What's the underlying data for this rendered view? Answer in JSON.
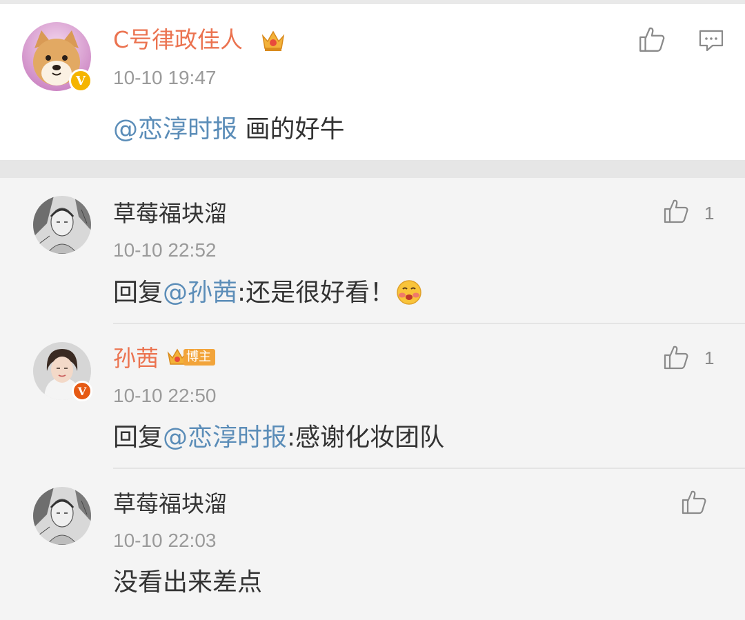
{
  "main_comment": {
    "author": "C号律政佳人",
    "time": "10-10 19:47",
    "mention": "@恋淳时报",
    "text": " 画的好牛",
    "avatar_icon": "shiba-dog-avatar",
    "verified_color": "#f5b400"
  },
  "replies": [
    {
      "author": "草莓福块溜",
      "time": "10-10 22:52",
      "prefix": "回复",
      "mention": "@孙茜",
      "text": ":还是很好看！",
      "likes": "1",
      "emoji": "blushing-face-emoji"
    },
    {
      "author": "孙茜",
      "badge": "博主",
      "time": "10-10 22:50",
      "prefix": "回复",
      "mention": "@恋淳时报",
      "text": ":感谢化妆团队",
      "likes": "1",
      "verified_color": "#e65a14"
    },
    {
      "author": "草莓福块溜",
      "time": "10-10 22:03",
      "text": "没看出来差点"
    }
  ],
  "colors": {
    "orange_name": "#eb7350",
    "mention": "#5b8db8",
    "timestamp": "#9a9a9a"
  }
}
